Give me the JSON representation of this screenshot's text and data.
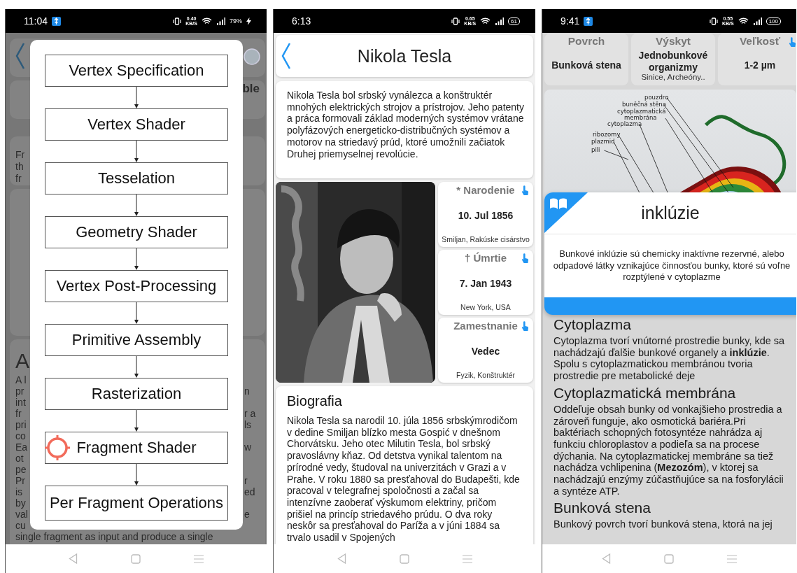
{
  "pipeline_screen": {
    "status_bar": {
      "time": "11:04",
      "notification": true,
      "speed": "0.40",
      "speed_unit": "KB/S",
      "battery": {
        "kind": "text",
        "value": "79%",
        "charging": true
      }
    },
    "background": {
      "side_label": "ble",
      "snippet_lines": [
        "Fr",
        "th",
        "fr"
      ],
      "heading": "A",
      "rows": [
        {
          "left": "A l"
        },
        {
          "left": "pr",
          "right": "n"
        },
        {
          "left": "int"
        },
        {
          "left": "fr",
          "right": "r a"
        },
        {
          "left": "pri",
          "right": "ls"
        },
        {
          "left": "co"
        },
        {
          "left": "Ea",
          "right": "w"
        },
        {
          "left": "ot"
        },
        {
          "left": "pe"
        },
        {
          "left": "Pr",
          "right": "r"
        },
        {
          "left": "is",
          "right": "ed"
        },
        {
          "left": "by"
        },
        {
          "left": "val",
          "right": "e"
        },
        {
          "left": "cu"
        }
      ],
      "last_line": "single fragment as input and produce a single"
    },
    "dialog": {
      "stages": [
        {
          "label": "Vertex Specification",
          "touched": false
        },
        {
          "label": "Vertex Shader",
          "touched": false
        },
        {
          "label": "Tesselation",
          "touched": false
        },
        {
          "label": "Geometry Shader",
          "touched": false
        },
        {
          "label": "Vertex Post-Processing",
          "touched": false
        },
        {
          "label": "Primitive Assembly",
          "touched": false
        },
        {
          "label": "Rasterization",
          "touched": false
        },
        {
          "label": "Fragment Shader",
          "touched": true
        },
        {
          "label": "Per Fragment Operations",
          "touched": false
        }
      ]
    }
  },
  "person_screen": {
    "status_bar": {
      "time": "6:13",
      "notification": false,
      "speed": "0.65",
      "speed_unit": "KB/S",
      "battery": {
        "kind": "pill",
        "value": "61"
      }
    },
    "title": "Nikola Tesla",
    "intro": "Nikola Tesla bol srbský vynálezca a konštruktér mnohých elektrických strojov a prístrojov. Jeho patenty a práca formovali základ moderných systémov vrátane polyfázových energeticko-distribučných systémov a motorov na striedavý prúd, ktoré umožnili začiatok  Druhej priemyselnej revolúcie.",
    "facts": [
      {
        "title": "* Narodenie",
        "value": "10. Jul 1856",
        "detail": "Smiljan, Rakúske cisárstvo"
      },
      {
        "title": "† Úmrtie",
        "value": "7. Jan 1943",
        "detail": "New York, USA"
      },
      {
        "title": "Zamestnanie",
        "value": "Vedec",
        "detail": "Fyzik, Konštruktér"
      }
    ],
    "biography": {
      "heading": "Biografia",
      "text": "Nikola Tesla sa narodil 10. júla 1856 srbskýmrodičom v dedine Smiljan blízko mesta Gospić v dnešnom Chorvátsku. Jeho otec Milutin Tesla, bol srbský pravoslávny kňaz. Od detstva vynikal talentom na prírodné vedy, študoval na univerzitách v Grazi a v Prahe. V roku 1880 sa presťahoval do Budapešti, kde pracoval v telegrafnej spoločnosti a začal sa intenzívne zaoberať výskumom elektriny, pričom prišiel na princíp striedavého prúdu. O dva roky neskôr sa presťahoval do Paríža a v júni 1884 sa trvalo usadil v Spojených"
    }
  },
  "cell_screen": {
    "status_bar": {
      "time": "9:41",
      "notification": true,
      "speed": "0.55",
      "speed_unit": "KB/S",
      "battery": {
        "kind": "pill",
        "value": "100"
      }
    },
    "facts": [
      {
        "title": "Povrch",
        "value": "Bunková stena"
      },
      {
        "title": "Výskyt",
        "value": "Jednobunkové organizmy",
        "detail": "Sinice, Archeóny.."
      },
      {
        "title": "Veľkosť",
        "value": "1-2 µm"
      }
    ],
    "diagram_labels": [
      {
        "lines": [
          "pouzdro"
        ]
      },
      {
        "lines": [
          "buněčná stěna"
        ]
      },
      {
        "lines": [
          "cytoplazmatická",
          "membrána"
        ]
      },
      {
        "lines": [
          "cytoplazma"
        ]
      },
      {
        "lines": [
          "ribozomy"
        ]
      },
      {
        "lines": [
          "plazmid"
        ]
      },
      {
        "lines": [
          "pili"
        ]
      }
    ],
    "sections": [
      {
        "heading": "Cytoplazma",
        "text": "Cytoplazma tvorí vnútorné prostredie bunky, kde sa nachádzajú ďalšie bunkové organely a **inklúzie**. Spolu s cytoplazmatickou membránou tvoria prostredie pre metabolické deje"
      },
      {
        "heading": "Cytoplazmatická membrána",
        "text": "Oddeľuje obsah bunky od vonkajšieho prostredia a zároveň funguje, ako osmotická bariéra.Pri baktériach schopných fotosyntéze nahrádza aj funkciu chloroplastov a podieľa sa na procese dýchania. Na cytoplazmatickej membráne sa tiež nachádza vchlipenina (**Mezozóm**), v ktorej sa nachádzajú enzýmy zúčastňujúce sa na fosforylácii a syntéze ATP."
      },
      {
        "heading": "Bunková stena",
        "text": "Bunkový povrch tvorí bunková stena, ktorá na jej"
      }
    ],
    "popup": {
      "title": "inklúzie",
      "text": "Bunkové inklúzie sú chemicky inaktívne rezervné, alebo odpadové látky vznikajúce činnosťou bunky, ktoré sú voľne rozptýlené v cytoplazme"
    }
  }
}
